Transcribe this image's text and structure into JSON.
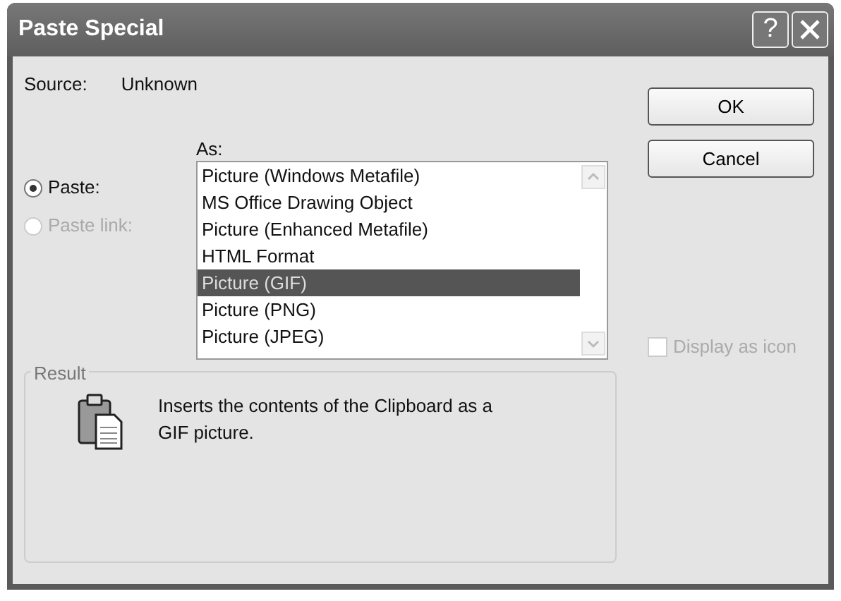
{
  "window": {
    "title": "Paste Special",
    "help_button": "?"
  },
  "source": {
    "label": "Source:",
    "value": "Unknown"
  },
  "as_label": "As:",
  "paste_options": [
    {
      "label": "Paste:",
      "selected": true,
      "disabled": false
    },
    {
      "label": "Paste link:",
      "selected": false,
      "disabled": true
    }
  ],
  "formats": [
    {
      "label": "Picture (Windows Metafile)",
      "selected": false
    },
    {
      "label": "MS Office Drawing Object",
      "selected": false
    },
    {
      "label": "Picture (Enhanced Metafile)",
      "selected": false
    },
    {
      "label": "HTML Format",
      "selected": false
    },
    {
      "label": "Picture (GIF)",
      "selected": true
    },
    {
      "label": "Picture (PNG)",
      "selected": false
    },
    {
      "label": "Picture (JPEG)",
      "selected": false
    }
  ],
  "buttons": [
    "OK",
    "Cancel"
  ],
  "display_as_icon": {
    "label": "Display as icon",
    "checked": false,
    "disabled": true
  },
  "result": {
    "title": "Result",
    "text": "Inserts the contents of the Clipboard as a GIF picture."
  }
}
